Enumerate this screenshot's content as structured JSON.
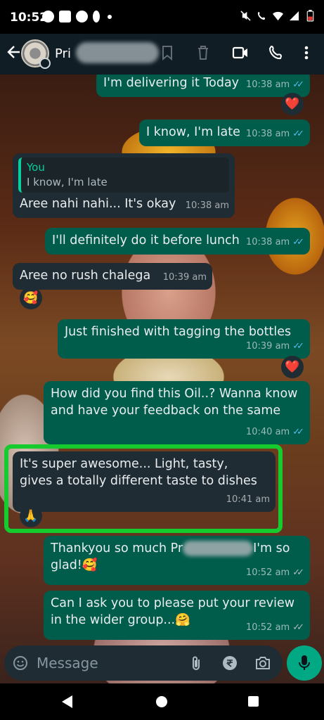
{
  "status_bar": {
    "time": "10:52"
  },
  "header": {
    "contact_name_visible": "Pri"
  },
  "messages": [
    {
      "text": "I'm delivering it Today",
      "time": "10:38 am",
      "reaction": "❤️"
    },
    {
      "text": "I know, I'm late",
      "time": "10:38 am"
    },
    {
      "quote_author": "You",
      "quote_text": "I know, I'm late",
      "text": "Aree nahi nahi... It's okay",
      "time": "10:38 am"
    },
    {
      "text": "I'll definitely do it before lunch",
      "time": "10:38 am"
    },
    {
      "text": "Aree no rush chalega",
      "time": "10:39 am",
      "reaction": "🥰"
    },
    {
      "text": "Just finished with tagging the bottles",
      "time": "10:39 am",
      "reaction": "❤️"
    },
    {
      "text": "How did you find this Oil..? Wanna know and have your feedback on the same",
      "time": "10:40 am"
    },
    {
      "text": "It's super awesome... Light, tasty, gives a totally different  taste to dishes",
      "time": "10:41 am",
      "reaction": "🙏"
    },
    {
      "text_before": "Thankyou so much Pr",
      "text_after": "I'm so glad!🥰",
      "time": "10:52 am"
    },
    {
      "text": "Can I ask you to please put your review in the wider group...🤗",
      "time": "10:52 am"
    }
  ],
  "composer": {
    "placeholder": "Message"
  },
  "colors": {
    "outgoing": "#005c4b",
    "incoming": "#202c33",
    "accent": "#00a884",
    "highlight": "#16cb2e"
  }
}
